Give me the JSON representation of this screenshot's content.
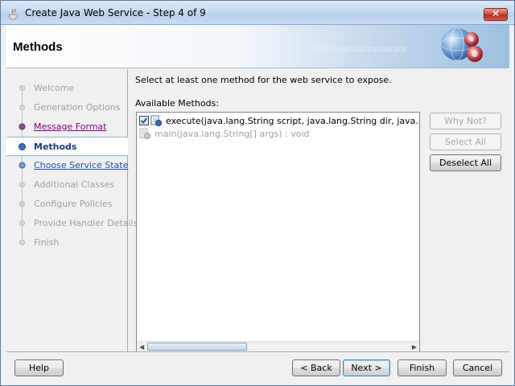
{
  "window": {
    "title": "Create Java Web Service - Step 4 of 9"
  },
  "header": {
    "title": "Methods",
    "decoration_text": "010101010101010101010101010"
  },
  "nav": {
    "items": [
      {
        "label": "Welcome",
        "state": "disabled"
      },
      {
        "label": "Generation Options",
        "state": "disabled"
      },
      {
        "label": "Message Format",
        "state": "visited"
      },
      {
        "label": "Methods",
        "state": "current"
      },
      {
        "label": "Choose Service State",
        "state": "link"
      },
      {
        "label": "Additional Classes",
        "state": "disabled"
      },
      {
        "label": "Configure Policies",
        "state": "disabled"
      },
      {
        "label": "Provide Handler Details",
        "state": "disabled"
      },
      {
        "label": "Finish",
        "state": "disabled"
      }
    ]
  },
  "main": {
    "instruction": "Select at least one method for the web service to expose.",
    "available_label": "Available Methods:",
    "methods": [
      {
        "text": "execute(java.lang.String script, java.lang.String dir, java.lang.Str",
        "checked": true,
        "enabled": true
      },
      {
        "text": "main(java.lang.String[] args) : void",
        "checked": false,
        "enabled": false
      }
    ],
    "buttons": {
      "why_not": "Why Not?",
      "select_all": "Select All",
      "deselect_all": "Deselect All"
    }
  },
  "footer": {
    "help": "Help",
    "back": "< Back",
    "next": "Next >",
    "finish": "Finish",
    "cancel": "Cancel"
  },
  "colors": {
    "accent": "#1d3c74",
    "link": "#1f4fa8",
    "visited": "#800080",
    "disabled": "#a0a0a0"
  }
}
